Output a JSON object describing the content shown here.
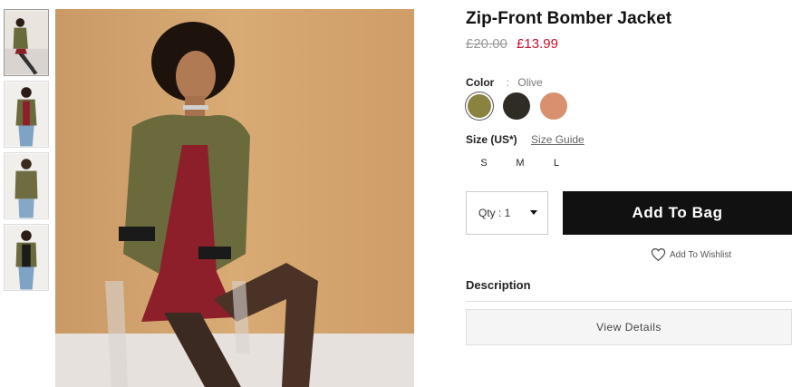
{
  "product": {
    "title": "Zip-Front Bomber Jacket",
    "price_original": "£20.00",
    "price_sale": "£13.99"
  },
  "color": {
    "label": "Color",
    "separator": ":",
    "selected": "Olive",
    "swatches": [
      {
        "name": "Olive",
        "hex": "#8a8240"
      },
      {
        "name": "Black",
        "hex": "#2e2c24"
      },
      {
        "name": "Salmon",
        "hex": "#d9906e"
      }
    ]
  },
  "size": {
    "label": "Size (US*)",
    "guide_link": "Size Guide",
    "options": [
      "S",
      "M",
      "L"
    ]
  },
  "qty": {
    "label": "Qty : 1"
  },
  "actions": {
    "add_to_bag": "Add To Bag",
    "wishlist": "Add To Wishlist"
  },
  "description": {
    "heading": "Description",
    "view_details": "View Details"
  },
  "colors": {
    "sale": "#c8102e",
    "button": "#111111",
    "photo_backdrop": "#d2a06a"
  }
}
